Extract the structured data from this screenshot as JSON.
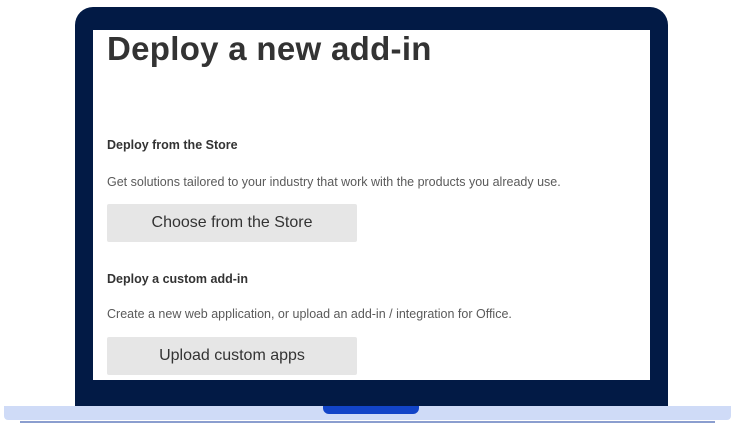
{
  "page": {
    "title": "Deploy a new add-in"
  },
  "store_section": {
    "heading": "Deploy from the Store",
    "description": "Get solutions tailored to your industry that work with the products you already use.",
    "button_label": "Choose from the Store"
  },
  "custom_section": {
    "heading": "Deploy a custom add-in",
    "description": "Create a new web application, or upload an add-in / integration for Office.",
    "button_label": "Upload custom apps"
  },
  "colors": {
    "laptop_frame": "#021a45",
    "laptop_base": "#cfdbf7",
    "laptop_notch": "#1244c8",
    "button_bg": "#e6e6e6"
  }
}
